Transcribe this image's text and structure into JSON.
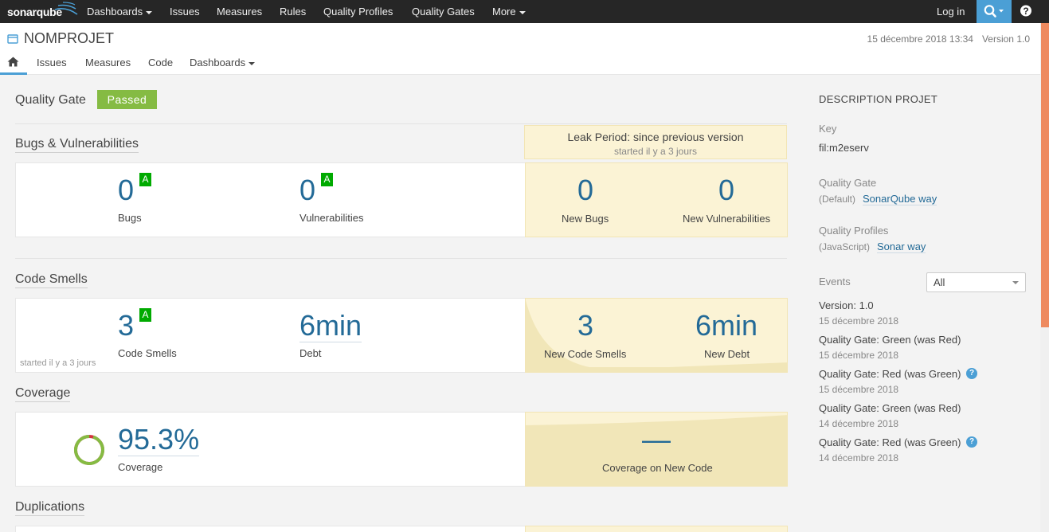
{
  "topnav": {
    "logo": "sonarqube",
    "items": [
      "Dashboards",
      "Issues",
      "Measures",
      "Rules",
      "Quality Profiles",
      "Quality Gates",
      "More"
    ],
    "login": "Log in",
    "search_icon": "search-icon",
    "help_icon": "help-icon",
    "help_glyph": "?"
  },
  "project": {
    "name": "NOMPROJET",
    "date": "15 décembre 2018 13:34",
    "version": "Version 1.0",
    "tabs": [
      "Issues",
      "Measures",
      "Code",
      "Dashboards"
    ]
  },
  "quality_gate": {
    "label": "Quality Gate",
    "status": "Passed"
  },
  "leak": {
    "title": "Leak Period: since previous version",
    "started": "started il y a 3 jours"
  },
  "bugs": {
    "title": "Bugs & Vulnerabilities",
    "bugs_value": "0",
    "bugs_rating": "A",
    "bugs_label": "Bugs",
    "vuln_value": "0",
    "vuln_rating": "A",
    "vuln_label": "Vulnerabilities",
    "new_bugs_value": "0",
    "new_bugs_label": "New Bugs",
    "new_vuln_value": "0",
    "new_vuln_label": "New Vulnerabilities"
  },
  "smells": {
    "title": "Code Smells",
    "started": "started il y a 3 jours",
    "smells_value": "3",
    "smells_rating": "A",
    "smells_label": "Code Smells",
    "debt_value": "6min",
    "debt_label": "Debt",
    "new_smells_value": "3",
    "new_smells_label": "New Code Smells",
    "new_debt_value": "6min",
    "new_debt_label": "New Debt"
  },
  "coverage": {
    "title": "Coverage",
    "value": "95.3%",
    "value_pct": 95.3,
    "label": "Coverage",
    "new_value": "—",
    "new_label": "Coverage on New Code"
  },
  "duplications": {
    "title": "Duplications"
  },
  "sidebar": {
    "heading": "DESCRIPTION PROJET",
    "key_label": "Key",
    "key_value": "fil:m2eserv",
    "qg_label": "Quality Gate",
    "qg_prefix": "(Default)",
    "qg_link": "SonarQube way",
    "qp_label": "Quality Profiles",
    "qp_prefix": "(JavaScript)",
    "qp_link": "Sonar way",
    "events_label": "Events",
    "events_filter": "All",
    "events": [
      {
        "title": "Version: 1.0",
        "date": "15 décembre 2018",
        "help": false
      },
      {
        "title": "Quality Gate: Green (was Red)",
        "date": "15 décembre 2018",
        "help": false
      },
      {
        "title": "Quality Gate: Red (was Green)",
        "date": "15 décembre 2018",
        "help": true
      },
      {
        "title": "Quality Gate: Green (was Red)",
        "date": "14 décembre 2018",
        "help": false
      },
      {
        "title": "Quality Gate: Red (was Green)",
        "date": "14 décembre 2018",
        "help": true
      }
    ]
  },
  "colors": {
    "accent": "#4b9fd5",
    "passed": "#85bb43",
    "rating_a": "#00aa00",
    "leak_bg": "#fbf3d5",
    "value": "#236a97",
    "scroll": "#ee8a5f"
  }
}
